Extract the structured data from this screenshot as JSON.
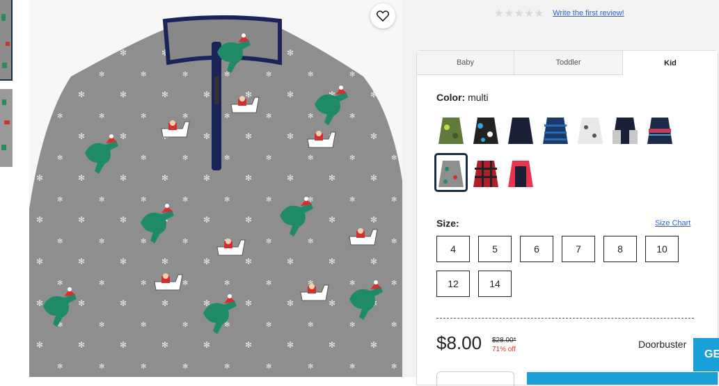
{
  "reviews": {
    "stars": "★★★★★",
    "link": "Write the first review!"
  },
  "tabs": [
    "Baby",
    "Toddler",
    "Kid"
  ],
  "color": {
    "label": "Color:",
    "value": "multi"
  },
  "swatches": [
    {
      "name": "green-camo"
    },
    {
      "name": "blue-dino"
    },
    {
      "name": "navy-solid"
    },
    {
      "name": "navy-stripe"
    },
    {
      "name": "white-print"
    },
    {
      "name": "navy-gray"
    },
    {
      "name": "fair-isle"
    },
    {
      "name": "gray-dino-print",
      "selected": true
    },
    {
      "name": "red-plaid"
    },
    {
      "name": "pink-navy"
    }
  ],
  "size": {
    "label": "Size:",
    "chart_link": "Size Chart",
    "options": [
      "4",
      "5",
      "6",
      "7",
      "8",
      "10",
      "12",
      "14"
    ]
  },
  "price": {
    "current": "$8.00",
    "original": "$28.00*",
    "discount": "71% off",
    "badge": "Doorbuster"
  },
  "get_button": "GE",
  "colors": {
    "accent": "#1aa0d8",
    "selected_border": "#1a2b44",
    "sale_red": "#d53a2b"
  }
}
